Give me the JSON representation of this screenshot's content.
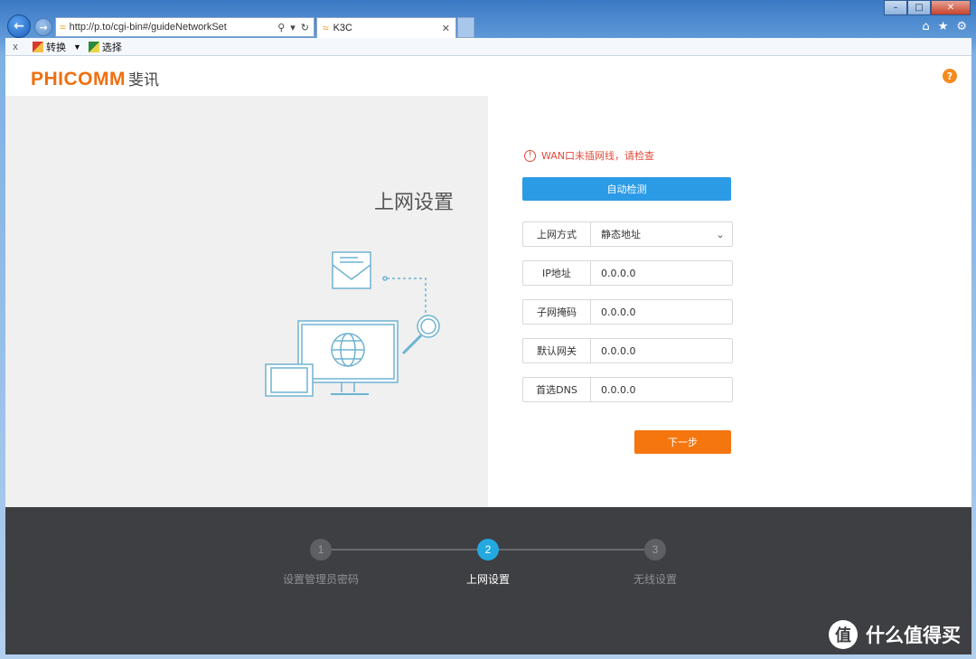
{
  "browser": {
    "url": "http://p.to/cgi-bin#/guideNetworkSet",
    "tab_title": "K3C",
    "toolbar": {
      "close_label": "x",
      "convert_label": "转换",
      "select_label": "选择"
    }
  },
  "header": {
    "logo_en": "PHICOMM",
    "logo_cn": "斐讯",
    "help_label": "?"
  },
  "left": {
    "title": "上网设置"
  },
  "form": {
    "error": "WAN口未插网线，请检查",
    "auto_detect": "自动检测",
    "fields": [
      {
        "label": "上网方式",
        "value": "静态地址"
      },
      {
        "label": "IP地址",
        "value": "0.0.0.0"
      },
      {
        "label": "子网掩码",
        "value": "0.0.0.0"
      },
      {
        "label": "默认网关",
        "value": "0.0.0.0"
      },
      {
        "label": "首选DNS",
        "value": "0.0.0.0"
      }
    ],
    "next": "下一步"
  },
  "steps": [
    {
      "num": "1",
      "label": "设置管理员密码"
    },
    {
      "num": "2",
      "label": "上网设置"
    },
    {
      "num": "3",
      "label": "无线设置"
    }
  ],
  "watermark": {
    "icon": "值",
    "text": "什么值得买"
  }
}
